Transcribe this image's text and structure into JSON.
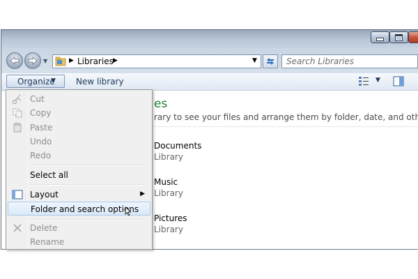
{
  "address": {
    "breadcrumb": "Libraries",
    "search_placeholder": "Search Libraries"
  },
  "toolbar": {
    "organize_label": "Organize",
    "new_library_label": "New library"
  },
  "content": {
    "heading_partial": "es",
    "description_partial": "rary to see your files and arrange them by folder, date, and other properties.",
    "libraries": [
      {
        "name": "Documents",
        "type": "Library"
      },
      {
        "name": "Music",
        "type": "Library"
      },
      {
        "name": "Pictures",
        "type": "Library"
      }
    ]
  },
  "organize_menu": {
    "items": [
      {
        "label": "Cut",
        "enabled": false,
        "icon": "scissors-icon"
      },
      {
        "label": "Copy",
        "enabled": false,
        "icon": "copy-icon"
      },
      {
        "label": "Paste",
        "enabled": false,
        "icon": "paste-icon"
      },
      {
        "label": "Undo",
        "enabled": false
      },
      {
        "label": "Redo",
        "enabled": false
      },
      {
        "label": "Select all",
        "enabled": true
      },
      {
        "label": "Layout",
        "enabled": true,
        "icon": "layout-icon",
        "submenu": true
      },
      {
        "label": "Folder and search options",
        "enabled": true,
        "highlighted": true
      },
      {
        "label": "Delete",
        "enabled": false,
        "icon": "delete-x-icon"
      },
      {
        "label": "Rename",
        "enabled": false
      }
    ]
  },
  "colors": {
    "heading_green": "#1e7e2e",
    "toolbar_text": "#1e395b",
    "disabled_text": "#8d8d8d",
    "highlight_border": "#a8c8ec"
  }
}
